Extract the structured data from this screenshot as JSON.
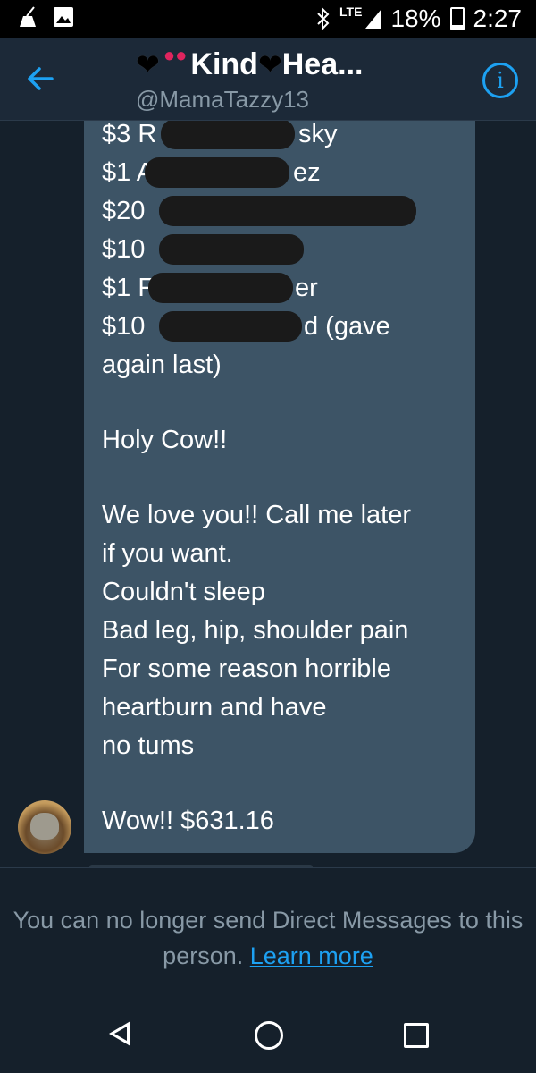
{
  "status_bar": {
    "network": "LTE",
    "battery": "18%",
    "time": "2:27"
  },
  "header": {
    "title": "Kind",
    "title_suffix": "Hea...",
    "handle": "@MamaTazzy13",
    "back_icon": "arrow-left-icon",
    "info_icon": "info-icon",
    "accent_color": "#1da1f2"
  },
  "message": {
    "bubble_color": "#3d5466",
    "lines": [
      {
        "text": "$3 R",
        "tail": "sky"
      },
      {
        "text": "$1 A",
        "tail": "ez"
      },
      {
        "text": "$20",
        "tail": ""
      },
      {
        "text": "$10",
        "tail": ""
      },
      {
        "text": "$1 F",
        "tail": "er"
      },
      {
        "text": "$10",
        "tail": "d (gave"
      },
      {
        "text": "again last)",
        "tail": ""
      }
    ],
    "paragraph_1": "Holy Cow!!",
    "paragraph_2": [
      "We love you!! Call me later",
      "if you want.",
      "Couldn't sleep",
      "Bad leg, hip, shoulder pain",
      "For some reason horrible",
      "heartburn and have",
      "no tums"
    ],
    "closing": "Wow!! $631.16"
  },
  "notice": {
    "text": "You can no longer send Direct Messages to this person.",
    "link": "Learn more"
  },
  "nav": {
    "back_icon": "nav-back-icon",
    "home_icon": "nav-home-icon",
    "recents_icon": "nav-recents-icon"
  }
}
